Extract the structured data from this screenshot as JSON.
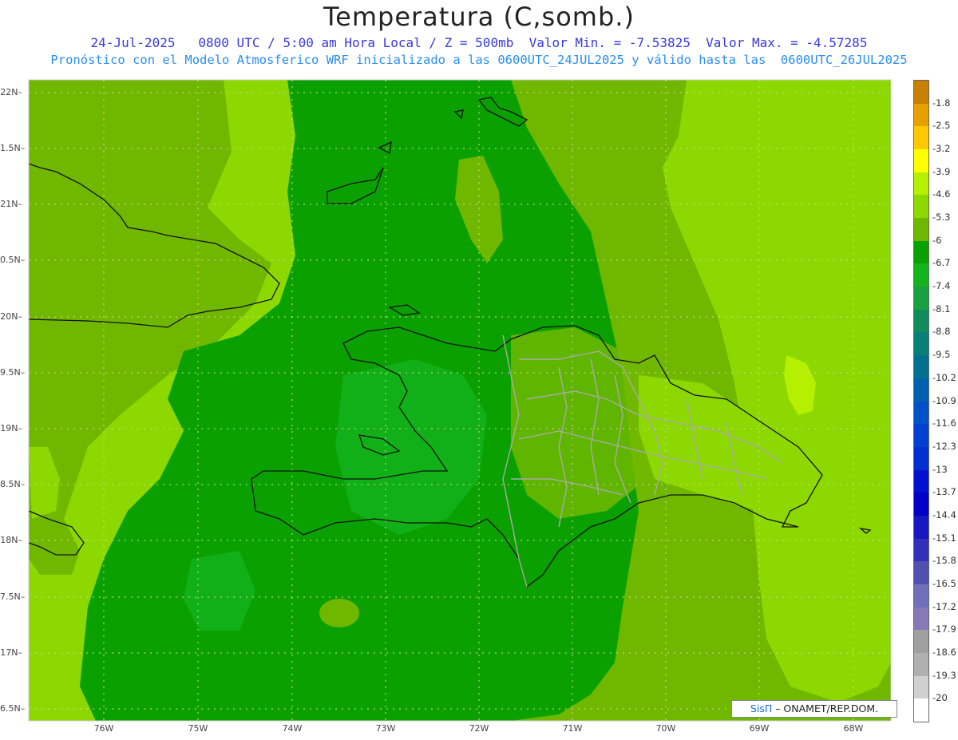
{
  "title": "Temperatura (C,somb.)",
  "subtitle_line1": "24-Jul-2025   0800 UTC / 5:00 am Hora Local / Z = 500mb  Valor Min. = -7.53825  Valor Max. = -4.57285",
  "subtitle_line2": "Pronóstico con el Modelo Atmosferico WRF inicializado a las 0600UTC_24JUL2025 y válido hasta las  0600UTC_26JUL2025",
  "lat_ticks": [
    "22N",
    "1.5N",
    "21N",
    "0.5N",
    "20N",
    "9.5N",
    "19N",
    "8.5N",
    "18N",
    "7.5N",
    "17N",
    "6.5N"
  ],
  "lon_ticks": [
    "76W",
    "75W",
    "74W",
    "73W",
    "72W",
    "71W",
    "70W",
    "69W",
    "68W"
  ],
  "colorbar": {
    "labels": [
      "-1.8",
      "-2.5",
      "-3.2",
      "-3.9",
      "-4.6",
      "-5.3",
      "-6",
      "-6.7",
      "-7.4",
      "-8.1",
      "-8.8",
      "-9.5",
      "-10.2",
      "-10.9",
      "-11.6",
      "-12.3",
      "-13",
      "-13.7",
      "-14.4",
      "-15.1",
      "-15.8",
      "-16.5",
      "-17.2",
      "-17.9",
      "-18.6",
      "-19.3",
      "-20"
    ],
    "colors": [
      "#c88000",
      "#e6a000",
      "#ffc800",
      "#ffff00",
      "#b4f000",
      "#8cd800",
      "#70b800",
      "#0aa000",
      "#14b41e",
      "#18a040",
      "#108c5a",
      "#088078",
      "#047090",
      "#0060b0",
      "#0050c8",
      "#0040d0",
      "#0030d0",
      "#0010d0",
      "#0000c8",
      "#1818c0",
      "#3030b8",
      "#5050b0",
      "#7070b8",
      "#8878b8",
      "#a0a0a0",
      "#b0b0b0",
      "#d0d0d0",
      "#ffffff"
    ]
  },
  "credit": {
    "brand": "SisΠ",
    "text": " – ONAMET/REP.DOM."
  },
  "colors": {
    "field_light": "#8cd800",
    "field_mid": "#70b800",
    "field_dark": "#0aa000",
    "field_darker": "#14b41e",
    "field_bright": "#b4f000",
    "border": "#111111",
    "province": "#aaaaaa"
  }
}
